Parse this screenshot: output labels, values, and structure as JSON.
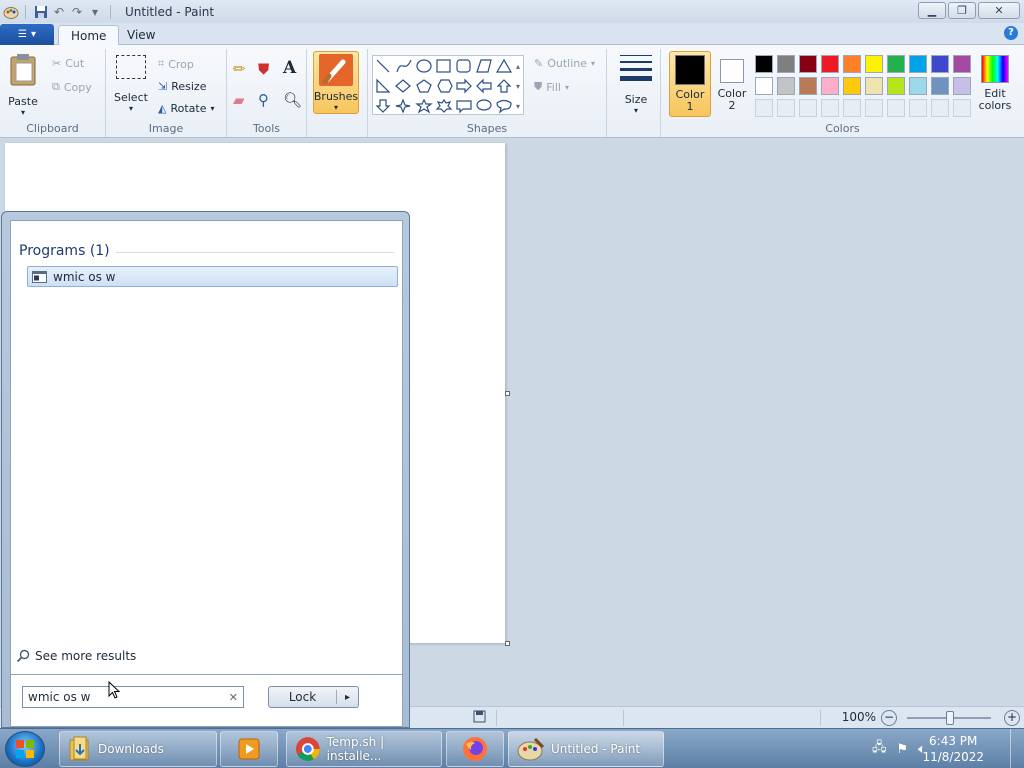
{
  "window": {
    "title": "Untitled - Paint"
  },
  "ribbon": {
    "tabs": [
      "Home",
      "View"
    ],
    "clipboard": {
      "paste": "Paste",
      "cut": "Cut",
      "copy": "Copy",
      "label": "Clipboard"
    },
    "image": {
      "select": "Select",
      "crop": "Crop",
      "resize": "Resize",
      "rotate": "Rotate",
      "label": "Image"
    },
    "tools": {
      "label": "Tools"
    },
    "brushes": {
      "label": "Brushes"
    },
    "shapes": {
      "outline": "Outline",
      "fill": "Fill",
      "label": "Shapes"
    },
    "size": {
      "label": "Size"
    },
    "colors": {
      "color1_line1": "Color",
      "color1_line2": "1",
      "color2_line1": "Color",
      "color2_line2": "2",
      "edit_line1": "Edit",
      "edit_line2": "colors",
      "label": "Colors",
      "palette_row1": [
        "#000000",
        "#7f7f7f",
        "#880015",
        "#ed1c24",
        "#ff7f27",
        "#fff200",
        "#22b14c",
        "#00a2e8",
        "#3f48cc",
        "#a349a4"
      ],
      "palette_row2": [
        "#ffffff",
        "#c3c3c3",
        "#b97a57",
        "#ffaec9",
        "#ffc90e",
        "#efe4b0",
        "#b5e61d",
        "#99d9ea",
        "#7092be",
        "#c8bfe7"
      ]
    }
  },
  "statusbar": {
    "zoom": "100%"
  },
  "startmenu": {
    "section_header": "Programs (1)",
    "result_label": "wmic os w",
    "see_more": "See more results",
    "search_value": "wmic os w",
    "lock_label": "Lock"
  },
  "taskbar": {
    "items": [
      "Downloads",
      "Temp.sh | installe...",
      "Untitled - Paint"
    ],
    "time": "6:43 PM",
    "date": "11/8/2022"
  }
}
